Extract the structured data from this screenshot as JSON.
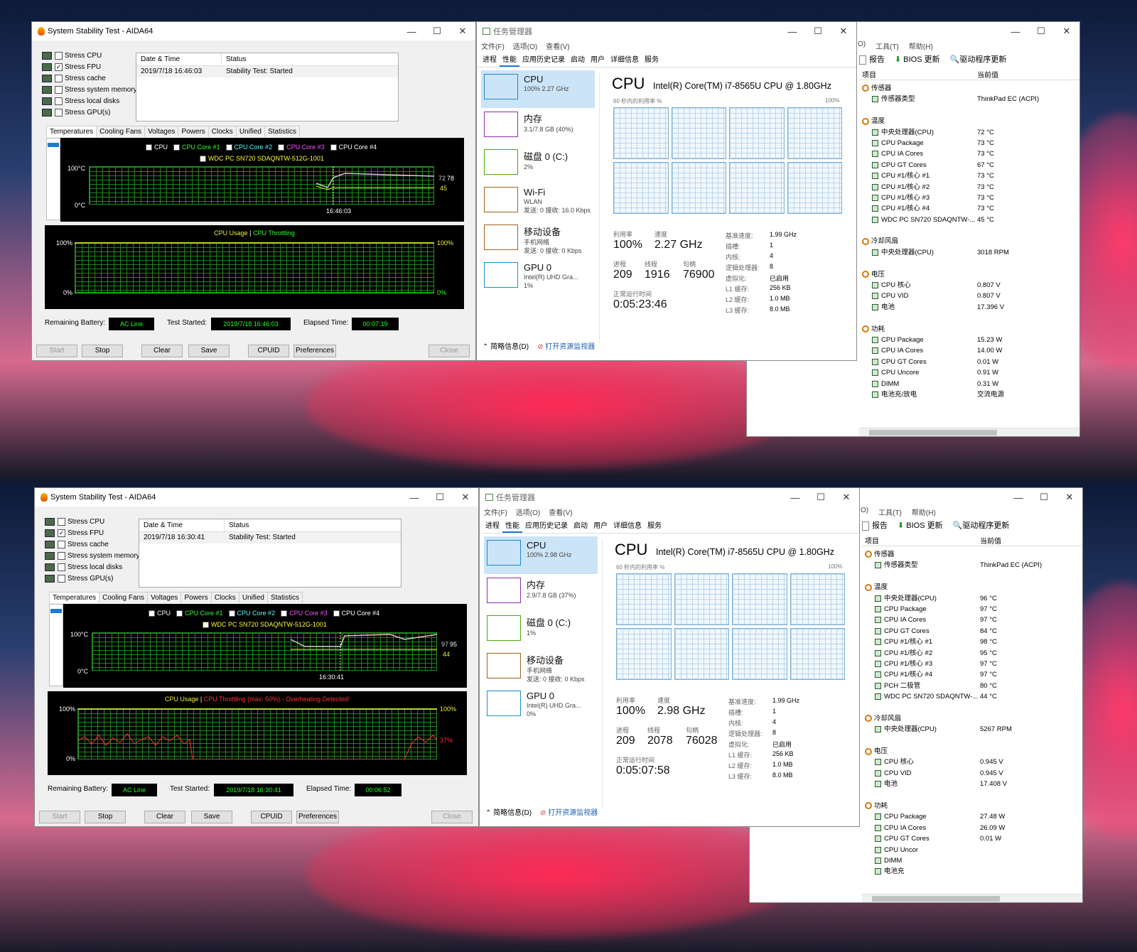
{
  "panels": [
    {
      "aida": {
        "title": "System Stability Test - AIDA64",
        "stress": [
          {
            "label": "Stress CPU",
            "checked": false
          },
          {
            "label": "Stress FPU",
            "checked": true
          },
          {
            "label": "Stress cache",
            "checked": false
          },
          {
            "label": "Stress system memory",
            "checked": false
          },
          {
            "label": "Stress local disks",
            "checked": false
          },
          {
            "label": "Stress GPU(s)",
            "checked": false
          }
        ],
        "log_headers": [
          "Date & Time",
          "Status"
        ],
        "log_row": [
          "2019/7/18 16:46:03",
          "Stability Test: Started"
        ],
        "tabs": [
          "Temperatures",
          "Cooling Fans",
          "Voltages",
          "Powers",
          "Clocks",
          "Unified",
          "Statistics"
        ],
        "legend1": [
          "CPU",
          "CPU Core #1",
          "CPU Core #2",
          "CPU Core #3",
          "CPU Core #4"
        ],
        "legend2": "WDC PC SN720 SDAQNTW-512G-1001",
        "temp_top": "100°C",
        "temp_bottom": "0°C",
        "temp_time": "16:46:03",
        "temp_r1": "72",
        "temp_r2": "78",
        "temp_r3": "45",
        "usage_title": "CPU Usage",
        "usage_sep": "|",
        "throttle_title": "CPU Throttling",
        "usage_top": "100%",
        "usage_bottom": "0%",
        "usage_right_top": "100%",
        "usage_right_bottom": "0%",
        "battery_label": "Remaining Battery:",
        "battery": "AC Line",
        "started_label": "Test Started:",
        "started": "2019/7/18 16:46:03",
        "elapsed_label": "Elapsed Time:",
        "elapsed": "00:07:19",
        "buttons": [
          "Start",
          "Stop",
          "Clear",
          "Save",
          "CPUID",
          "Preferences",
          "Close"
        ]
      },
      "tm": {
        "title": "任务管理器",
        "menu": [
          "文件(F)",
          "选项(O)",
          "查看(V)"
        ],
        "tabs": [
          "进程",
          "性能",
          "应用历史记录",
          "启动",
          "用户",
          "详细信息",
          "服务"
        ],
        "side": [
          {
            "name": "CPU",
            "sub1": "100% 2.27 GHz",
            "sub2": ""
          },
          {
            "name": "内存",
            "sub1": "3.1/7.8 GB (40%)",
            "sub2": ""
          },
          {
            "name": "磁盘 0 (C:)",
            "sub1": "2%",
            "sub2": ""
          },
          {
            "name": "Wi-Fi",
            "sub1": "WLAN",
            "sub2": "发送: 0 接收: 16.0 Kbps"
          },
          {
            "name": "移动设备",
            "sub1": "手机网络",
            "sub2": "发送: 0 接收: 0 Kbps"
          },
          {
            "name": "GPU 0",
            "sub1": "Intel(R) UHD Gra...",
            "sub2": "1%"
          }
        ],
        "cpu_title": "CPU",
        "cpu_model": "Intel(R) Core(TM) i7-8565U CPU @ 1.80GHz",
        "graph_label": "60 秒内的利用率 %",
        "graph_max": "100%",
        "util_k": "利用率",
        "util": "100%",
        "speed_k": "速度",
        "speed": "2.27 GHz",
        "proc_k": "进程",
        "proc": "209",
        "thr_k": "线程",
        "thr": "1916",
        "hnd_k": "句柄",
        "hnd": "76900",
        "uptime_k": "正常运行时间",
        "uptime": "0:05:23:46",
        "spec": [
          [
            "基准速度:",
            "1.99 GHz"
          ],
          [
            "插槽:",
            "1"
          ],
          [
            "内核:",
            "4"
          ],
          [
            "逻辑处理器:",
            "8"
          ],
          [
            "虚拟化:",
            "已启用"
          ],
          [
            "L1 缓存:",
            "256 KB"
          ],
          [
            "L2 缓存:",
            "1.0 MB"
          ],
          [
            "L3 缓存:",
            "8.0 MB"
          ]
        ],
        "brief": "简略信息(D)",
        "resmon": "打开资源监视器"
      },
      "hw": {
        "menu": [
          "O)",
          "工具(T)",
          "帮助(H)"
        ],
        "toolbar": [
          "报告",
          "BIOS 更新",
          "驱动程序更新"
        ],
        "col_item": "项目",
        "col_val": "当前值",
        "rows": [
          {
            "t": "g",
            "n": "传感器",
            "v": ""
          },
          {
            "t": "i",
            "n": "传感器类型",
            "v": "ThinkPad EC  (ACPI)"
          },
          {
            "t": "s",
            "n": "",
            "v": ""
          },
          {
            "t": "g",
            "n": "温度",
            "v": ""
          },
          {
            "t": "i",
            "n": "中央处理器(CPU)",
            "v": "72 °C"
          },
          {
            "t": "i",
            "n": "CPU Package",
            "v": "73 °C"
          },
          {
            "t": "i",
            "n": "CPU IA Cores",
            "v": "73 °C"
          },
          {
            "t": "i",
            "n": "CPU GT Cores",
            "v": "67 °C"
          },
          {
            "t": "i",
            "n": "CPU #1/核心 #1",
            "v": "73 °C"
          },
          {
            "t": "i",
            "n": "CPU #1/核心 #2",
            "v": "73 °C"
          },
          {
            "t": "i",
            "n": "CPU #1/核心 #3",
            "v": "73 °C"
          },
          {
            "t": "i",
            "n": "CPU #1/核心 #4",
            "v": "73 °C"
          },
          {
            "t": "i",
            "n": "WDC PC SN720 SDAQNTW-...",
            "v": "45 °C"
          },
          {
            "t": "s",
            "n": "",
            "v": ""
          },
          {
            "t": "g",
            "n": "冷却风扇",
            "v": ""
          },
          {
            "t": "i",
            "n": "中央处理器(CPU)",
            "v": "3018 RPM"
          },
          {
            "t": "s",
            "n": "",
            "v": ""
          },
          {
            "t": "g",
            "n": "电压",
            "v": ""
          },
          {
            "t": "i",
            "n": "CPU 核心",
            "v": "0.807 V"
          },
          {
            "t": "i",
            "n": "CPU VID",
            "v": "0.807 V"
          },
          {
            "t": "i",
            "n": "电池",
            "v": "17.396 V"
          },
          {
            "t": "s",
            "n": "",
            "v": ""
          },
          {
            "t": "g",
            "n": "功耗",
            "v": ""
          },
          {
            "t": "i",
            "n": "CPU Package",
            "v": "15.23 W"
          },
          {
            "t": "i",
            "n": "CPU IA Cores",
            "v": "14.00 W"
          },
          {
            "t": "i",
            "n": "CPU GT Cores",
            "v": "0.01 W"
          },
          {
            "t": "i",
            "n": "CPU Uncore",
            "v": "0.91 W"
          },
          {
            "t": "i",
            "n": "DIMM",
            "v": "0.31 W"
          },
          {
            "t": "i",
            "n": "电池充/放电",
            "v": "交流电源"
          }
        ]
      }
    },
    {
      "aida": {
        "title": "System Stability Test - AIDA64",
        "stress": [
          {
            "label": "Stress CPU",
            "checked": false
          },
          {
            "label": "Stress FPU",
            "checked": true
          },
          {
            "label": "Stress cache",
            "checked": false
          },
          {
            "label": "Stress system memory",
            "checked": false
          },
          {
            "label": "Stress local disks",
            "checked": false
          },
          {
            "label": "Stress GPU(s)",
            "checked": false
          }
        ],
        "log_headers": [
          "Date & Time",
          "Status"
        ],
        "log_row": [
          "2019/7/18 16:30:41",
          "Stability Test: Started"
        ],
        "tabs": [
          "Temperatures",
          "Cooling Fans",
          "Voltages",
          "Powers",
          "Clocks",
          "Unified",
          "Statistics"
        ],
        "legend1": [
          "CPU",
          "CPU Core #1",
          "CPU Core #2",
          "CPU Core #3",
          "CPU Core #4"
        ],
        "legend2": "WDC PC SN720 SDAQNTW-512G-1001",
        "temp_top": "100°C",
        "temp_bottom": "0°C",
        "temp_time": "16:30:41",
        "temp_r1": "97",
        "temp_r2": "95",
        "temp_r3": "44",
        "usage_title": "CPU Usage",
        "usage_sep": "|",
        "throttle_title": "CPU Throttling (max: 50%) - Overheating Detected!",
        "usage_top": "100%",
        "usage_bottom": "0%",
        "usage_right_top": "100%",
        "usage_right_bottom": "37%",
        "battery_label": "Remaining Battery:",
        "battery": "AC Line",
        "started_label": "Test Started:",
        "started": "2019/7/18 16:30:41",
        "elapsed_label": "Elapsed Time:",
        "elapsed": "00:06:52",
        "buttons": [
          "Start",
          "Stop",
          "Clear",
          "Save",
          "CPUID",
          "Preferences",
          "Close"
        ]
      },
      "tm": {
        "title": "任务管理器",
        "menu": [
          "文件(F)",
          "选项(O)",
          "查看(V)"
        ],
        "tabs": [
          "进程",
          "性能",
          "应用历史记录",
          "启动",
          "用户",
          "详细信息",
          "服务"
        ],
        "side": [
          {
            "name": "CPU",
            "sub1": "100% 2.98 GHz",
            "sub2": ""
          },
          {
            "name": "内存",
            "sub1": "2.9/7.8 GB (37%)",
            "sub2": ""
          },
          {
            "name": "磁盘 0 (C:)",
            "sub1": "1%",
            "sub2": ""
          },
          {
            "name": "移动设备",
            "sub1": "手机网络",
            "sub2": "发送: 0 接收: 0 Kbps"
          },
          {
            "name": "GPU 0",
            "sub1": "Intel(R) UHD Gra...",
            "sub2": "0%"
          }
        ],
        "cpu_title": "CPU",
        "cpu_model": "Intel(R) Core(TM) i7-8565U CPU @ 1.80GHz",
        "graph_label": "60 秒内的利用率 %",
        "graph_max": "100%",
        "util_k": "利用率",
        "util": "100%",
        "speed_k": "速度",
        "speed": "2.98 GHz",
        "proc_k": "进程",
        "proc": "209",
        "thr_k": "线程",
        "thr": "2078",
        "hnd_k": "句柄",
        "hnd": "76028",
        "uptime_k": "正常运行时间",
        "uptime": "0:05:07:58",
        "spec": [
          [
            "基准速度:",
            "1.99 GHz"
          ],
          [
            "插槽:",
            "1"
          ],
          [
            "内核:",
            "4"
          ],
          [
            "逻辑处理器:",
            "8"
          ],
          [
            "虚拟化:",
            "已启用"
          ],
          [
            "L1 缓存:",
            "256 KB"
          ],
          [
            "L2 缓存:",
            "1.0 MB"
          ],
          [
            "L3 缓存:",
            "8.0 MB"
          ]
        ],
        "brief": "简略信息(D)",
        "resmon": "打开资源监视器"
      },
      "hw": {
        "menu": [
          "O)",
          "工具(T)",
          "帮助(H)"
        ],
        "toolbar": [
          "报告",
          "BIOS 更新",
          "驱动程序更新"
        ],
        "col_item": "项目",
        "col_val": "当前值",
        "rows": [
          {
            "t": "g",
            "n": "传感器",
            "v": ""
          },
          {
            "t": "i",
            "n": "传感器类型",
            "v": "ThinkPad EC  (ACPI)"
          },
          {
            "t": "s",
            "n": "",
            "v": ""
          },
          {
            "t": "g",
            "n": "温度",
            "v": ""
          },
          {
            "t": "i",
            "n": "中央处理器(CPU)",
            "v": "96 °C"
          },
          {
            "t": "i",
            "n": "CPU Package",
            "v": "97 °C"
          },
          {
            "t": "i",
            "n": "CPU IA Cores",
            "v": "97 °C"
          },
          {
            "t": "i",
            "n": "CPU GT Cores",
            "v": "84 °C"
          },
          {
            "t": "i",
            "n": "CPU #1/核心 #1",
            "v": "98 °C"
          },
          {
            "t": "i",
            "n": "CPU #1/核心 #2",
            "v": "95 °C"
          },
          {
            "t": "i",
            "n": "CPU #1/核心 #3",
            "v": "97 °C"
          },
          {
            "t": "i",
            "n": "CPU #1/核心 #4",
            "v": "97 °C"
          },
          {
            "t": "i",
            "n": "PCH 二极管",
            "v": "80 °C"
          },
          {
            "t": "i",
            "n": "WDC PC SN720 SDAQNTW-...",
            "v": "44 °C"
          },
          {
            "t": "s",
            "n": "",
            "v": ""
          },
          {
            "t": "g",
            "n": "冷却风扇",
            "v": ""
          },
          {
            "t": "i",
            "n": "中央处理器(CPU)",
            "v": "5267 RPM"
          },
          {
            "t": "s",
            "n": "",
            "v": ""
          },
          {
            "t": "g",
            "n": "电压",
            "v": ""
          },
          {
            "t": "i",
            "n": "CPU 核心",
            "v": "0.945 V"
          },
          {
            "t": "i",
            "n": "CPU VID",
            "v": "0.945 V"
          },
          {
            "t": "i",
            "n": "电池",
            "v": "17.408 V"
          },
          {
            "t": "s",
            "n": "",
            "v": ""
          },
          {
            "t": "g",
            "n": "功耗",
            "v": ""
          },
          {
            "t": "i",
            "n": "CPU Package",
            "v": "27.48 W"
          },
          {
            "t": "i",
            "n": "CPU IA Cores",
            "v": "26.09 W"
          },
          {
            "t": "i",
            "n": "CPU GT Cores",
            "v": "0.01 W"
          },
          {
            "t": "i",
            "n": "CPU Uncor",
            "v": ""
          },
          {
            "t": "i",
            "n": "DIMM",
            "v": ""
          },
          {
            "t": "i",
            "n": "电池充",
            "v": ""
          }
        ]
      }
    }
  ]
}
